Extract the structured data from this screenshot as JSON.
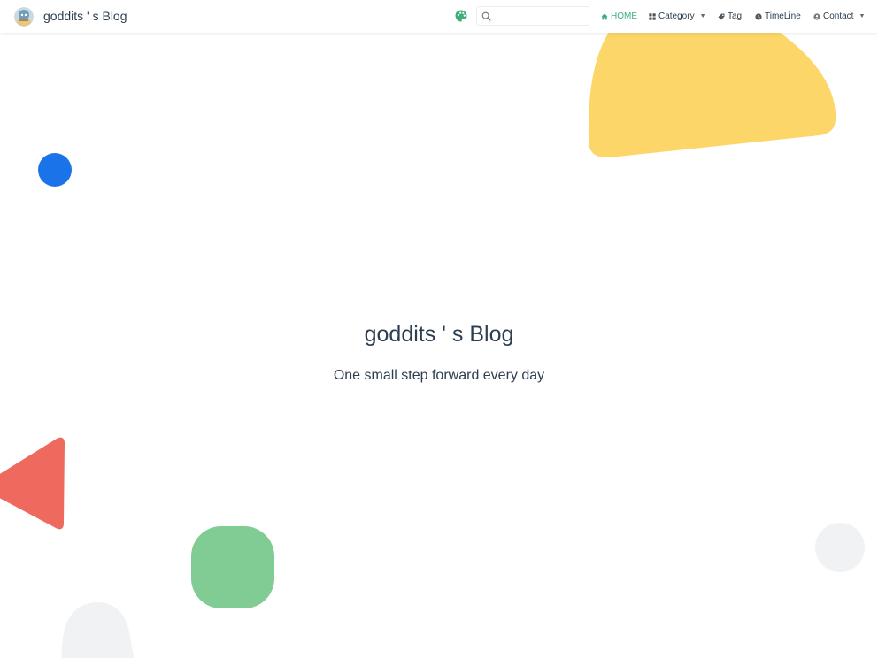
{
  "navbar": {
    "site_name": "goddits ' s Blog",
    "search": {
      "value": "",
      "placeholder": ""
    },
    "items": [
      {
        "label": "HOME",
        "icon": "home-icon",
        "active": true
      },
      {
        "label": "Category",
        "icon": "category-icon",
        "has_dropdown": true
      },
      {
        "label": "Tag",
        "icon": "tag-icon"
      },
      {
        "label": "TimeLine",
        "icon": "timeline-icon"
      },
      {
        "label": "Contact",
        "icon": "contact-icon",
        "has_dropdown": true
      }
    ],
    "dropdown_glyph": "▼"
  },
  "hero": {
    "title": "goddits ' s Blog",
    "tagline": "One small step forward every day"
  },
  "colors": {
    "accent": "#3eaf7c",
    "text": "#2c3e50",
    "shape_blue": "#1a73e8",
    "shape_yellow": "#fcd669",
    "shape_red": "#ee6a5e",
    "shape_green": "#81cb94",
    "shape_gray": "#f1f2f4"
  }
}
